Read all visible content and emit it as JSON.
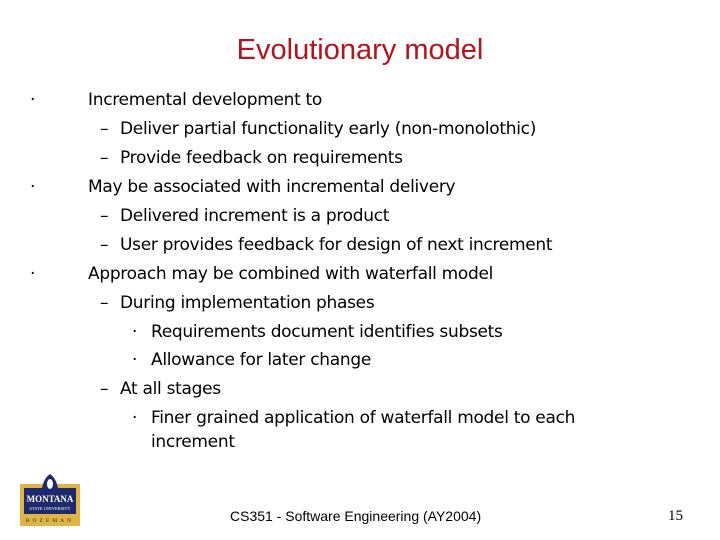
{
  "slide": {
    "title": "Evolutionary model",
    "bullets": [
      {
        "level": 1,
        "marker": "·",
        "text": "Incremental development to"
      },
      {
        "level": 2,
        "marker": "–",
        "text": "Deliver partial functionality early (non-monolothic)"
      },
      {
        "level": 2,
        "marker": "–",
        "text": "Provide feedback on requirements"
      },
      {
        "level": 1,
        "marker": "·",
        "text": "May be associated with incremental delivery"
      },
      {
        "level": 2,
        "marker": "–",
        "text": "Delivered increment is a product"
      },
      {
        "level": 2,
        "marker": "–",
        "text": "User provides feedback for design of next increment"
      },
      {
        "level": 1,
        "marker": "·",
        "text": "Approach may be combined with waterfall model"
      },
      {
        "level": 2,
        "marker": "–",
        "text": "During implementation phases"
      },
      {
        "level": 3,
        "marker": "·",
        "text": "Requirements document identifies subsets"
      },
      {
        "level": 3,
        "marker": "·",
        "text": "Allowance for later change"
      },
      {
        "level": 2,
        "marker": "–",
        "text": "At all stages"
      },
      {
        "level": 3,
        "marker": "·",
        "text": "Finer grained application of waterfall model to each"
      },
      {
        "level": 3,
        "marker": "",
        "text": "increment"
      }
    ],
    "footer": "CS351 - Software Engineering (AY2004)",
    "page_number": "15",
    "logo": {
      "line1": "MONTANA",
      "line2": "STATE UNIVERSITY",
      "line3": "BOZEMAN"
    },
    "colors": {
      "title": "#b4141b",
      "logo_navy": "#1e2a6e",
      "logo_gold": "#e0b541"
    }
  }
}
